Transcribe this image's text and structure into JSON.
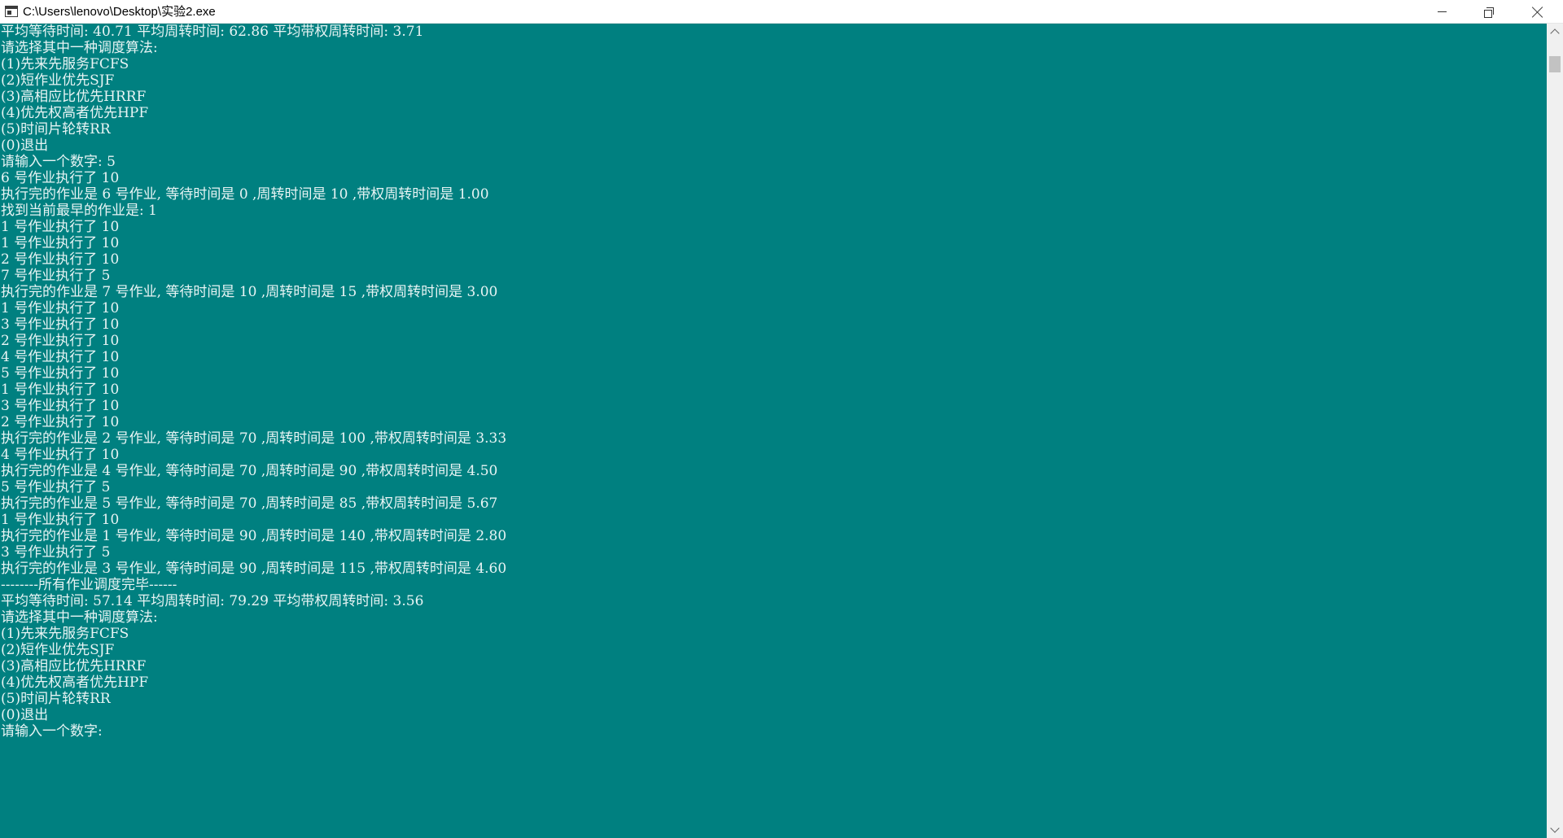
{
  "window": {
    "title": "C:\\Users\\lenovo\\Desktop\\实验2.exe",
    "icon": "console-app-icon",
    "controls": {
      "minimize": "minimize-icon",
      "maximize": "restore-icon",
      "close": "close-icon"
    }
  },
  "colors": {
    "console_background": "#008080",
    "console_text": "#e8f4f4",
    "titlebar_background": "#ffffff"
  },
  "console": {
    "lines": [
      "平均等待时间: 40.71 平均周转时间: 62.86 平均带权周转时间: 3.71",
      "请选择其中一种调度算法:",
      "(1)先来先服务FCFS",
      "(2)短作业优先SJF",
      "(3)高相应比优先HRRF",
      "(4)优先权高者优先HPF",
      "(5)时间片轮转RR",
      "(0)退出",
      "请输入一个数字: 5",
      "6 号作业执行了 10",
      "执行完的作业是 6 号作业, 等待时间是 0 ,周转时间是 10 ,带权周转时间是 1.00",
      "找到当前最早的作业是: 1",
      "1 号作业执行了 10",
      "1 号作业执行了 10",
      "2 号作业执行了 10",
      "7 号作业执行了 5",
      "执行完的作业是 7 号作业, 等待时间是 10 ,周转时间是 15 ,带权周转时间是 3.00",
      "1 号作业执行了 10",
      "3 号作业执行了 10",
      "2 号作业执行了 10",
      "4 号作业执行了 10",
      "5 号作业执行了 10",
      "1 号作业执行了 10",
      "3 号作业执行了 10",
      "2 号作业执行了 10",
      "执行完的作业是 2 号作业, 等待时间是 70 ,周转时间是 100 ,带权周转时间是 3.33",
      "4 号作业执行了 10",
      "执行完的作业是 4 号作业, 等待时间是 70 ,周转时间是 90 ,带权周转时间是 4.50",
      "5 号作业执行了 5",
      "执行完的作业是 5 号作业, 等待时间是 70 ,周转时间是 85 ,带权周转时间是 5.67",
      "1 号作业执行了 10",
      "执行完的作业是 1 号作业, 等待时间是 90 ,周转时间是 140 ,带权周转时间是 2.80",
      "3 号作业执行了 5",
      "执行完的作业是 3 号作业, 等待时间是 90 ,周转时间是 115 ,带权周转时间是 4.60",
      "--------所有作业调度完毕------",
      "平均等待时间: 57.14 平均周转时间: 79.29 平均带权周转时间: 3.56",
      "请选择其中一种调度算法:",
      "(1)先来先服务FCFS",
      "(2)短作业优先SJF",
      "(3)高相应比优先HRRF",
      "(4)优先权高者优先HPF",
      "(5)时间片轮转RR",
      "(0)退出",
      "请输入一个数字:"
    ]
  },
  "scrollbar": {
    "up_icon": "scroll-up-arrow-icon",
    "down_icon": "scroll-down-arrow-icon"
  }
}
